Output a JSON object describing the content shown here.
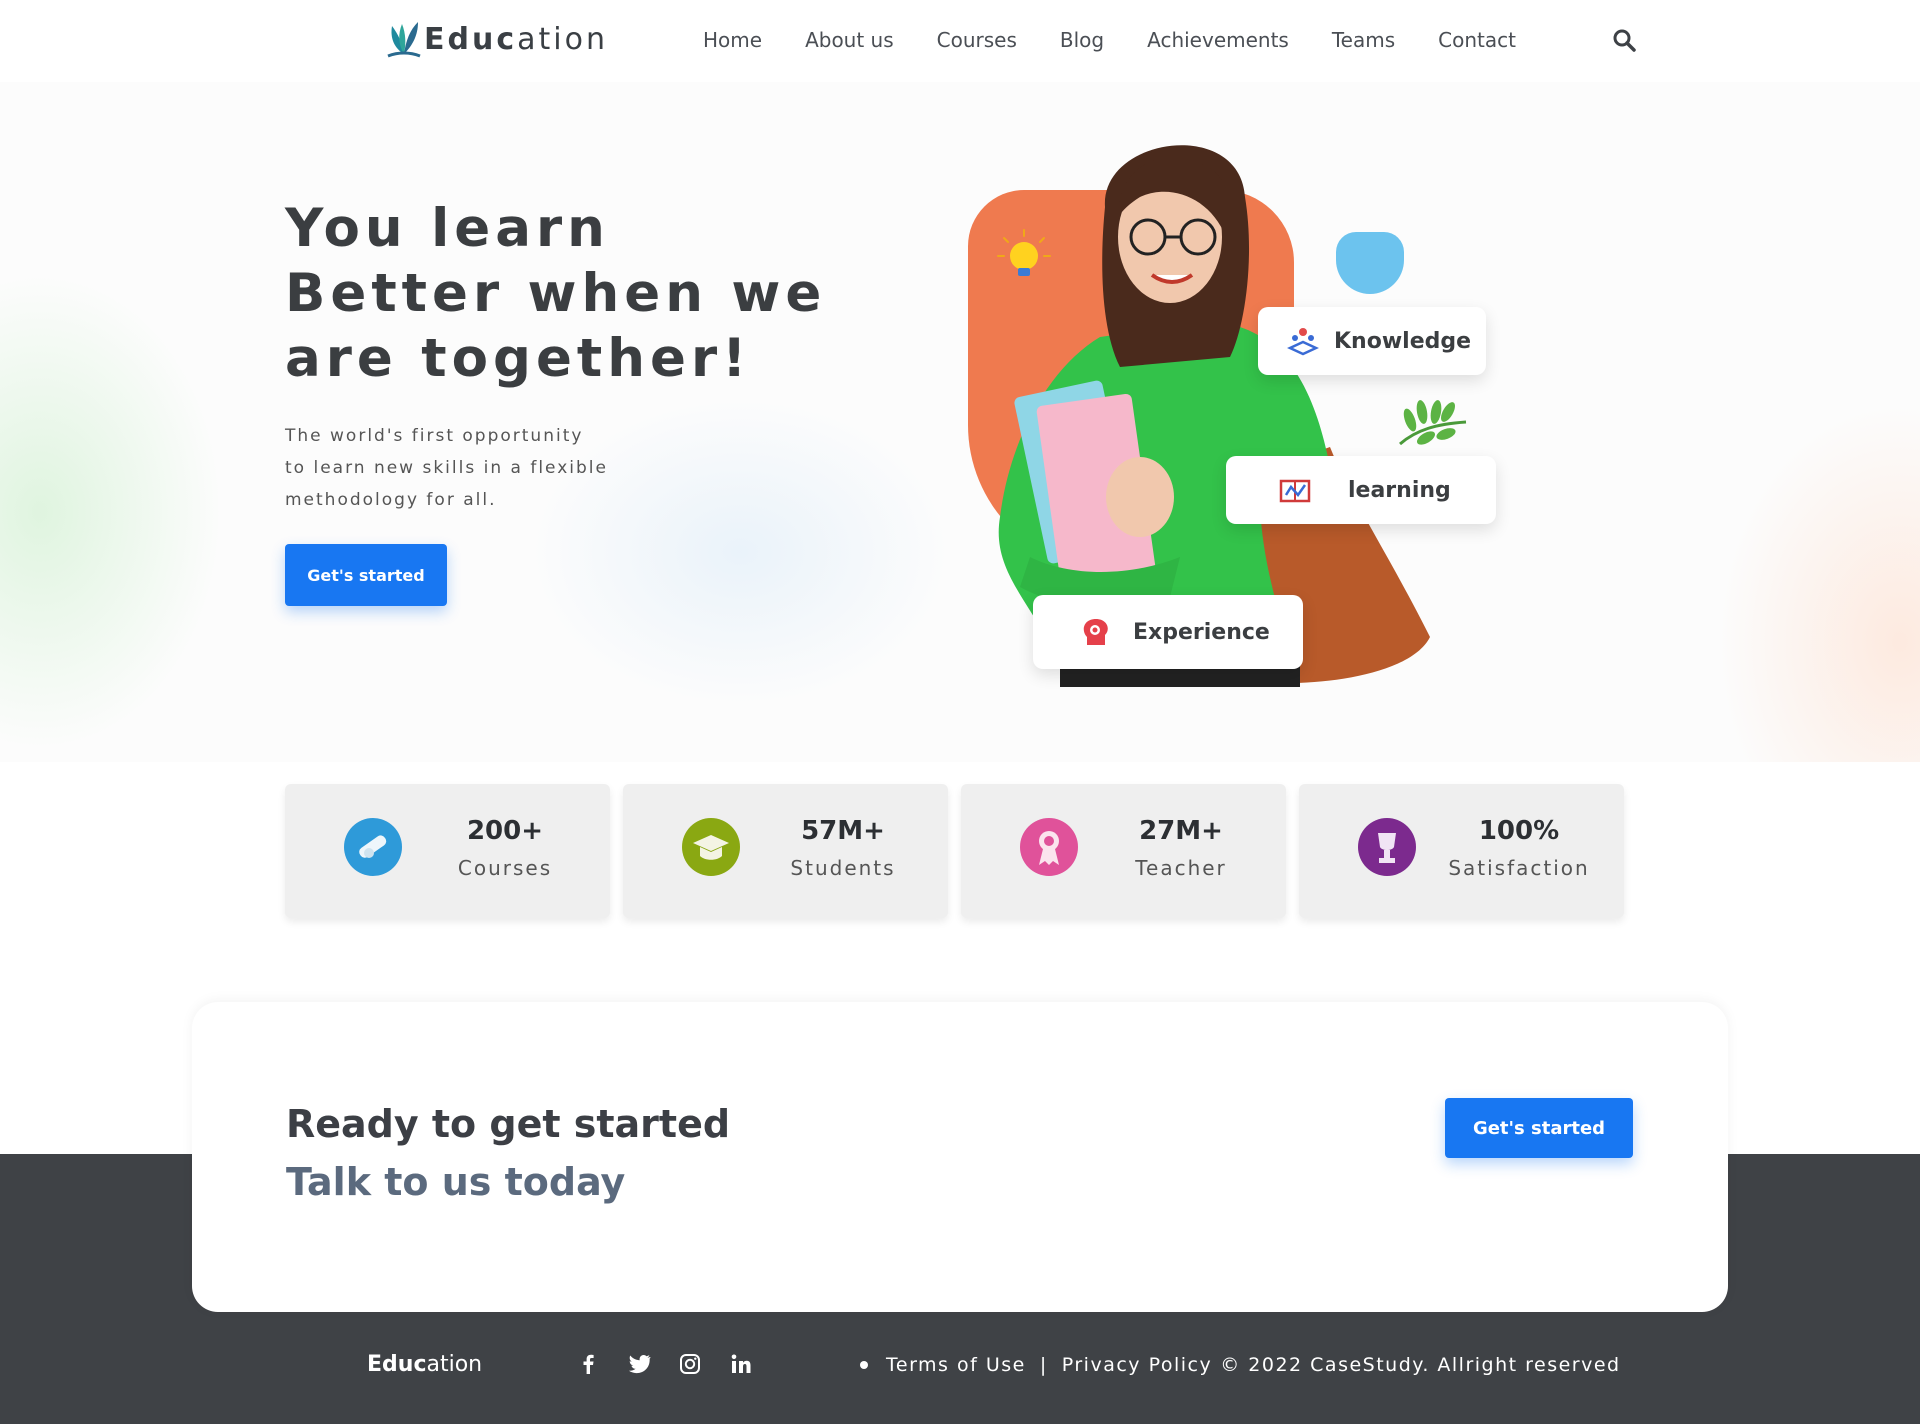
{
  "nav": {
    "logo_bold": "Educ",
    "logo_light": "ation",
    "links": [
      "Home",
      "About us",
      "Courses",
      "Blog",
      "Achievements",
      "Teams",
      "Contact"
    ]
  },
  "hero": {
    "title_lines": [
      "You learn",
      "Better when we",
      "are together!"
    ],
    "subtitle_lines": [
      "The world's first opportunity",
      "to learn new skills in a flexible",
      "methodology for all."
    ],
    "cta_label": "Get's started",
    "tags": {
      "knowledge": "Knowledge",
      "learning": "learning",
      "experience": "Experience"
    }
  },
  "stats": [
    {
      "value": "200+",
      "label": "Courses",
      "icon": "diploma-icon",
      "color": "#2e9ad9"
    },
    {
      "value": "57M+",
      "label": "Students",
      "icon": "graduation-cap-icon",
      "color": "#8aa812"
    },
    {
      "value": "27M+",
      "label": "Teacher",
      "icon": "award-ribbon-icon",
      "color": "#e0529a"
    },
    {
      "value": "100%",
      "label": "Satisfaction",
      "icon": "trophy-icon",
      "color": "#7c2a8e"
    }
  ],
  "cta": {
    "line1": "Ready to get started",
    "line2": "Talk to us today",
    "button_label": "Get's started"
  },
  "footer": {
    "brand_bold": "Educ",
    "brand_light": "ation",
    "socials": [
      "facebook-icon",
      "twitter-icon",
      "instagram-icon",
      "linkedin-icon"
    ],
    "terms": "Terms of Use",
    "separator": "|",
    "privacy": "Privacy Policy",
    "copyright": "© 2022 CaseStudy.  Allright reserved"
  },
  "colors": {
    "accent": "#1877f2",
    "footer_bg": "#3f4246",
    "blob": "#ef7a4f",
    "sweater": "#33c24a"
  }
}
